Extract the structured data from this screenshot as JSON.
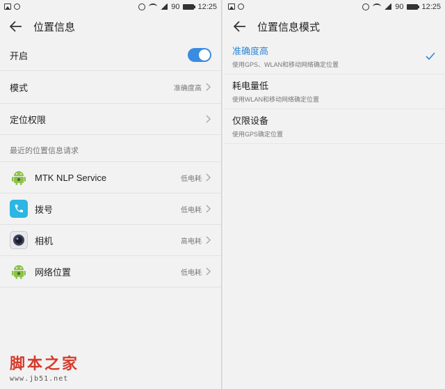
{
  "left": {
    "status": {
      "battery": "90",
      "time": "12:25"
    },
    "title": "位置信息",
    "toggle_row": {
      "label": "开启",
      "on": true
    },
    "mode_row": {
      "label": "模式",
      "value": "准确度高"
    },
    "permission_row": {
      "label": "定位权限"
    },
    "section_header": "最近的位置信息请求",
    "apps": [
      {
        "name": "MTK NLP Service",
        "usage": "低电耗",
        "icon": "android-icon"
      },
      {
        "name": "拨号",
        "usage": "低电耗",
        "icon": "phone-icon"
      },
      {
        "name": "相机",
        "usage": "高电耗",
        "icon": "camera-icon"
      },
      {
        "name": "网络位置",
        "usage": "低电耗",
        "icon": "android-icon"
      }
    ]
  },
  "right": {
    "status": {
      "battery": "90",
      "time": "12:25"
    },
    "title": "位置信息模式",
    "modes": [
      {
        "title": "准确度高",
        "desc": "使用GPS、WLAN和移动网络确定位置",
        "selected": true
      },
      {
        "title": "耗电量低",
        "desc": "使用WLAN和移动网络确定位置",
        "selected": false
      },
      {
        "title": "仅限设备",
        "desc": "使用GPS确定位置",
        "selected": false
      }
    ]
  },
  "watermark": {
    "text": "脚本之家",
    "url": "www.jb51.net"
  },
  "colors": {
    "accent": "#2e86d4",
    "toggle": "#3a8ce0",
    "android": "#8bc34a",
    "phone": "#2bb6e3",
    "watermark": "#d63a2a"
  }
}
